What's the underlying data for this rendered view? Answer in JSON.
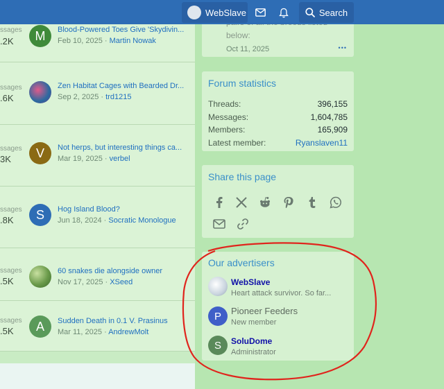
{
  "nav": {
    "username": "WebSlave",
    "search_label": "Search"
  },
  "threads": [
    {
      "msgs_label": "ssages",
      "count": ".2K",
      "avatar_letter": "M",
      "avatar_color": "#3f8a3a",
      "title": "Blood-Powered Toes Give 'Skydivin...",
      "date": "Feb 10, 2025",
      "user": "Martin Nowak"
    },
    {
      "msgs_label": "ssages",
      "count": ".6K",
      "avatar_letter": "",
      "avatar_color": "#7a3a8a",
      "title": "Zen Habitat Cages with Bearded Dr...",
      "date": "Sep 2, 2025",
      "user": "trd1215"
    },
    {
      "msgs_label": "ssages",
      "count": "3K",
      "avatar_letter": "V",
      "avatar_color": "#8a6a14",
      "title": "Not herps, but interesting things ca...",
      "date": "Mar 19, 2025",
      "user": "verbel"
    },
    {
      "msgs_label": "ssages",
      "count": ".8K",
      "avatar_letter": "S",
      "avatar_color": "#2e6db5",
      "title": "Hog Island Blood?",
      "date": "Jun 18, 2024",
      "user": "Socratic Monologue"
    },
    {
      "msgs_label": "ssages",
      "count": ".5K",
      "avatar_letter": "",
      "avatar_color": "#6a9a4a",
      "title": "60 snakes die alongside owner",
      "date": "Nov 17, 2025",
      "user": "XSeed"
    },
    {
      "msgs_label": "ssages",
      "count": ".5K",
      "avatar_letter": "A",
      "avatar_color": "#5a9a5a",
      "title": "Sudden Death in 0.1 V. Prasinus",
      "date": "Mar 11, 2025",
      "user": "AndrewMolt"
    }
  ],
  "top_block": {
    "text_line1": "pairs of all the breeds listed",
    "text_line2": "below:",
    "date": "Oct 11, 2025",
    "more": "•••"
  },
  "stats": {
    "title": "Forum statistics",
    "threads_label": "Threads:",
    "threads_value": "396,155",
    "messages_label": "Messages:",
    "messages_value": "1,604,785",
    "members_label": "Members:",
    "members_value": "165,909",
    "latest_label": "Latest member:",
    "latest_value": "Ryanslaven11"
  },
  "share": {
    "title": "Share this page",
    "icons": [
      "facebook-icon",
      "x-icon",
      "reddit-icon",
      "pinterest-icon",
      "tumblr-icon",
      "whatsapp-icon",
      "email-icon",
      "link-icon"
    ]
  },
  "advertisers": {
    "title": "Our advertisers",
    "items": [
      {
        "name": "WebSlave",
        "sub": "Heart attack survivor. So far...",
        "letter": "",
        "color": "#dfe6ee"
      },
      {
        "name": "Pioneer Feeders",
        "sub": "New member",
        "letter": "P",
        "color": "#3f5fc8"
      },
      {
        "name": "SoluDome",
        "sub": "Administrator",
        "letter": "S",
        "color": "#5a8a5a"
      }
    ]
  },
  "colors": {
    "nav_bg": "#2e6db5",
    "link": "#1f6fc0",
    "annotation": "#e0241c"
  }
}
